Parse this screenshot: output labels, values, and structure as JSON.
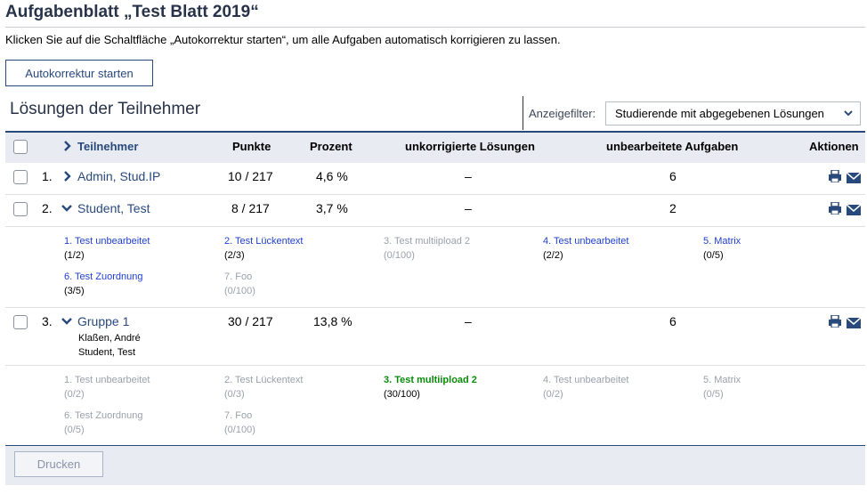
{
  "page": {
    "title": "Aufgabenblatt „Test Blatt 2019“",
    "hint": "Klicken Sie auf die Schaltfläche „Autokorrektur starten“, um alle Aufgaben automatisch korrigieren zu lassen.",
    "autocorrect_label": "Autokorrektur starten"
  },
  "table": {
    "caption": "Lösungen der Teilnehmer",
    "filter_label": "Anzeigefilter:",
    "filter_value": "Studierende mit abgegebenen Lösungen",
    "headers": {
      "participant": "Teilnehmer",
      "points": "Punkte",
      "percent": "Prozent",
      "uncorrected": "unkorrigierte Lösungen",
      "unprocessed": "unbearbeitete Aufgaben",
      "actions": "Aktionen"
    },
    "rows": [
      {
        "num": "1.",
        "name": "Admin, Stud.IP",
        "points": "10 / 217",
        "percent": "4,6 %",
        "uncorrected": "–",
        "unprocessed": "6"
      },
      {
        "num": "2.",
        "name": "Student, Test",
        "points": "8 / 217",
        "percent": "3,7 %",
        "uncorrected": "–",
        "unprocessed": "2"
      },
      {
        "num": "3.",
        "name": "Gruppe 1",
        "points": "30 / 217",
        "percent": "13,8 %",
        "uncorrected": "–",
        "unprocessed": "6",
        "members": [
          "Klaßen, André",
          "Student, Test"
        ]
      }
    ],
    "tasks_row2": [
      {
        "name": "1. Test unbearbeitet",
        "score": "(1/2)"
      },
      {
        "name": "2. Test Lückentext",
        "score": "(2/3)"
      },
      {
        "name": "3. Test multiipload 2",
        "score": "(0/100)"
      },
      {
        "name": "4. Test unbearbeitet",
        "score": "(2/2)"
      },
      {
        "name": "5. Matrix",
        "score": "(0/5)"
      },
      {
        "name": "6. Test Zuordnung",
        "score": "(3/5)"
      },
      {
        "name": "7. Foo",
        "score": "(0/100)"
      }
    ],
    "tasks_row3": [
      {
        "name": "1. Test unbearbeitet",
        "score": "(0/2)"
      },
      {
        "name": "2. Test Lückentext",
        "score": "(0/3)"
      },
      {
        "name": "3. Test multiipload 2",
        "score": "(30/100)"
      },
      {
        "name": "4. Test unbearbeitet",
        "score": "(0/2)"
      },
      {
        "name": "5. Matrix",
        "score": "(0/5)"
      },
      {
        "name": "6. Test Zuordnung",
        "score": "(0/5)"
      },
      {
        "name": "7. Foo",
        "score": "(0/100)"
      }
    ],
    "print_label": "Drucken"
  },
  "colors": {
    "brand": "#28497c",
    "header_bg": "#e8ebf2",
    "task_link": "#1f3fcf",
    "task_graded": "#0a8a0a",
    "task_muted": "#9aa0aa"
  },
  "icons": {
    "expand": "chevron-right-icon",
    "collapse": "chevron-down-icon",
    "print": "print-icon",
    "mail": "mail-icon",
    "dropdown": "chevron-down-icon"
  }
}
